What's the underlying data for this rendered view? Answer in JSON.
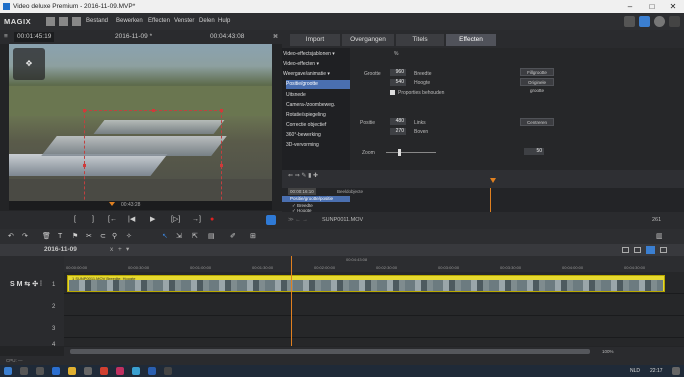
{
  "window": {
    "title": "Video deluxe Premium - 2016-11-09.MVP*",
    "minimize": "–",
    "maximize": "□",
    "close": "✕"
  },
  "menu": {
    "logo": "MAGIX",
    "items": [
      "Bestand",
      "Bewerken",
      "Effecten",
      "Venster",
      "Delen",
      "Hulp"
    ]
  },
  "preview": {
    "timecode_left": "00:01:45:19",
    "project_name": "2016-11-09 *",
    "timecode_right": "00:04:43:08",
    "strip_time": "00:43:28"
  },
  "transport": {
    "buttons": [
      "[",
      "]",
      "[←",
      "|◀",
      "▶",
      "[▷]",
      "→]",
      "●"
    ]
  },
  "tabs": [
    "Import",
    "Overgangen",
    "Titels",
    "Effecten"
  ],
  "effect_list": [
    "Video-effectsjablonen ▾",
    "Video-effecten ▾",
    "Weergave/animatie ▾",
    "Positie/grootte",
    "Uitsnede",
    "Camera-/zoombeweg.",
    "Rotatie/spiegeling",
    "Correctie objectief",
    "360°-bewerking",
    "3D-vervorming"
  ],
  "props": {
    "pct_label": "%",
    "grootte_label": "Grootte",
    "breedte_label": "Breedte",
    "breedte_value": "960",
    "hoogte_label": "Hoogte",
    "hoogte_value": "540",
    "btn_fill": "Fillgrootte",
    "btn_original": "Originele grootte",
    "keep_ratio": "Proporties behouden",
    "positie_label": "Positie",
    "links_label": "Links",
    "links_value": "480",
    "boven_label": "Boven",
    "boven_value": "270",
    "btn_center": "Centreren",
    "zoom_label": "Zoom",
    "zoom_value": "50"
  },
  "keyframes": {
    "field_time": "00:00:16:10",
    "col_label": "Beeldobjecte",
    "rows": [
      "Positie/grootte/positie",
      "✓ Breedte",
      "✓ Hoogte"
    ]
  },
  "right_bottom": {
    "file": "SUNP0011.MOV",
    "zoom": "261"
  },
  "project": {
    "name": "2016-11-09",
    "tab_close": "x",
    "tab_add": "+",
    "tab_arrow": "▾"
  },
  "ruler": {
    "marks": [
      "00:00:00:00",
      "00:00:30:00",
      "00:01:00:00",
      "00:01:30:00",
      "00:02:00:00",
      "00:02:30:00",
      "00:03:00:00",
      "00:03:30:00",
      "00:04:00:00",
      "00:04:30:00"
    ],
    "top_time": "00:04:43:08"
  },
  "tracks": {
    "labels": [
      "1",
      "2",
      "3",
      "4"
    ],
    "mode": "S M ⇆ ✣ ⫶",
    "clip_label": "1 SUNP0011.MOV   Breedte: Hoogte"
  },
  "scroll": {
    "zoom_pct": "100%"
  },
  "status": {
    "cpu": "CPU: —"
  },
  "taskbar": {
    "clock": "22:17",
    "lang": "NLD"
  },
  "colors": {
    "clip_yellow": "#e6d930",
    "selection": "#4a6fb0",
    "playhead": "#e08020",
    "record": "#e02020"
  }
}
